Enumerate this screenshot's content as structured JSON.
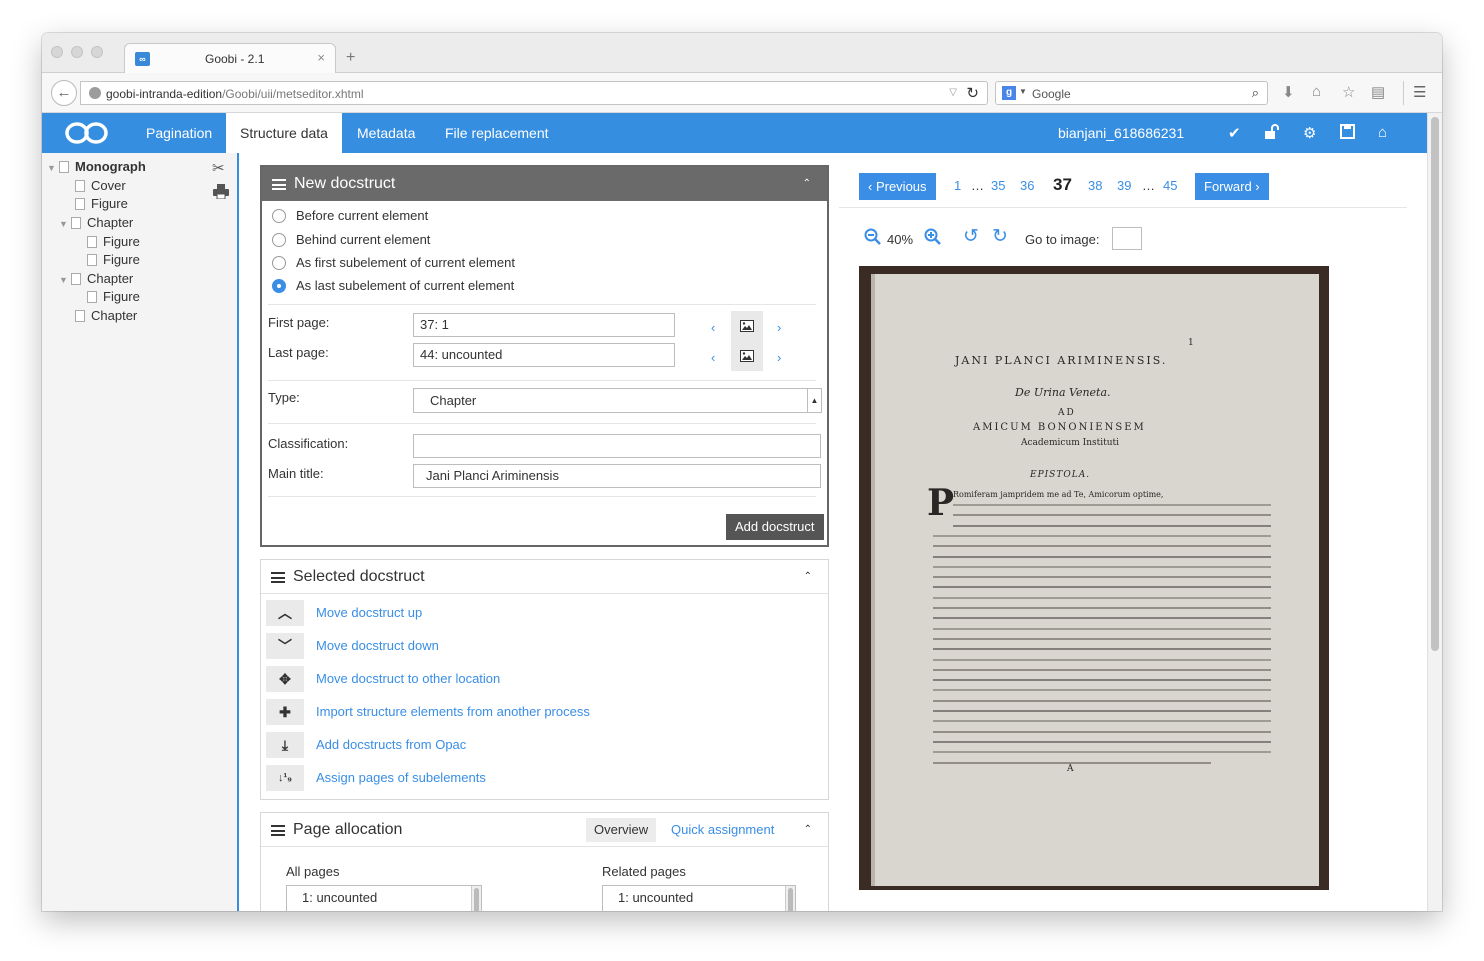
{
  "browser": {
    "tab_title": "Goobi - 2.1",
    "tab_close": "×",
    "new_tab": "+",
    "url_host": "goobi-intranda-edition",
    "url_path": "/Goobi/uii/metseditor.xhtml",
    "search_placeholder": "Google"
  },
  "app": {
    "tabs": [
      "Pagination",
      "Structure data",
      "Metadata",
      "File replacement"
    ],
    "active_tab": "Structure data",
    "record_id": "bianjani_618686231"
  },
  "tree": {
    "items": [
      {
        "label": "Monograph",
        "level": 0
      },
      {
        "label": "Cover",
        "level": 1
      },
      {
        "label": "Figure",
        "level": 1
      },
      {
        "label": "Chapter",
        "level": 1
      },
      {
        "label": "Figure",
        "level": 2
      },
      {
        "label": "Figure",
        "level": 2
      },
      {
        "label": "Chapter",
        "level": 1
      },
      {
        "label": "Figure",
        "level": 2
      },
      {
        "label": "Chapter",
        "level": 1
      }
    ]
  },
  "new_docstruct": {
    "title": "New docstruct",
    "options": [
      "Before current element",
      "Behind current element",
      "As first subelement of current element",
      "As last subelement of current element"
    ],
    "selected_option": "As last subelement of current element",
    "first_page_label": "First page:",
    "first_page_value": "37: 1",
    "last_page_label": "Last page:",
    "last_page_value": "44: uncounted",
    "type_label": "Type:",
    "type_value": "Chapter",
    "classification_label": "Classification:",
    "classification_value": "",
    "main_title_label": "Main title:",
    "main_title_value": "Jani Planci Ariminensis",
    "add_button": "Add docstruct"
  },
  "selected_docstruct": {
    "title": "Selected docstruct",
    "actions": [
      {
        "icon": "chevron-up",
        "label": "Move docstruct up"
      },
      {
        "icon": "chevron-down",
        "label": "Move docstruct down"
      },
      {
        "icon": "move",
        "label": "Move docstruct to other location"
      },
      {
        "icon": "puzzle",
        "label": "Import structure elements from another process"
      },
      {
        "icon": "download",
        "label": "Add docstructs from Opac"
      },
      {
        "icon": "sort-numeric",
        "label": "Assign pages of subelements"
      }
    ]
  },
  "page_allocation": {
    "title": "Page allocation",
    "tab_overview": "Overview",
    "tab_quick": "Quick assignment",
    "all_pages_label": "All pages",
    "related_pages_label": "Related pages",
    "all_pages_items": [
      "1: uncounted"
    ],
    "related_pages_items": [
      "1: uncounted"
    ]
  },
  "viewer": {
    "previous": "Previous",
    "forward": "Forward",
    "pages": [
      "1",
      "…",
      "35",
      "36",
      "37",
      "38",
      "39",
      "…",
      "45"
    ],
    "current_page": "37",
    "zoom": "40%",
    "goto_label": "Go to image:",
    "goto_value": "",
    "scan": {
      "page_no": "1",
      "heading": "JANI PLANCI ARIMINENSIS.",
      "subheading": "De Urina Veneta.",
      "ad": "AD",
      "addressee": "AMICUM BONONIENSEM",
      "institution": "Academicum Instituti",
      "epistola": "EPISTOLA.",
      "dropcap": "P",
      "first_line": "Romiferam jampridem me ad Te, Amicorum optime,",
      "signature": "A"
    }
  }
}
